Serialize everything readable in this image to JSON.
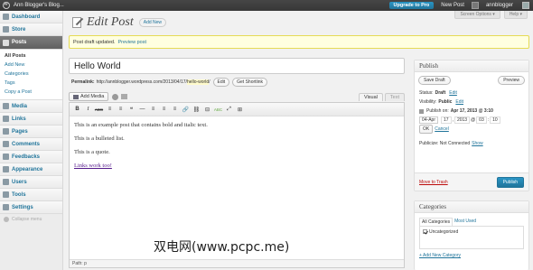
{
  "adminbar": {
    "site_name": "Ann Blogger's Blog...",
    "upgrade_label": "Upgrade to Pro",
    "new_post_label": "New Post",
    "username": "annblogger"
  },
  "screen_options": {
    "options_label": "Screen Options ▾",
    "help_label": "Help ▾"
  },
  "sidebar": {
    "items_top": [
      {
        "label": "Dashboard"
      },
      {
        "label": "Store"
      }
    ],
    "active": {
      "label": "Posts"
    },
    "submenu": [
      {
        "label": "All Posts"
      },
      {
        "label": "Add New"
      },
      {
        "label": "Categories"
      },
      {
        "label": "Tags"
      },
      {
        "label": "Copy a Post"
      }
    ],
    "items_bottom": [
      {
        "label": "Media"
      },
      {
        "label": "Links"
      },
      {
        "label": "Pages"
      },
      {
        "label": "Comments"
      },
      {
        "label": "Feedbacks"
      },
      {
        "label": "Appearance"
      },
      {
        "label": "Users"
      },
      {
        "label": "Tools"
      },
      {
        "label": "Settings"
      }
    ],
    "collapse_label": "Collapse menu"
  },
  "page": {
    "title": "Edit Post",
    "add_new_label": "Add New"
  },
  "notice": {
    "text": "Post draft updated.",
    "link": "Preview post"
  },
  "post": {
    "title": "Hello World",
    "permalink_label": "Permalink:",
    "permalink_base": "http://annblogger.wordpress.com/2013/04/17/",
    "permalink_slug": "hello-world",
    "permalink_end": "/",
    "edit_label": "Edit",
    "shortlink_label": "Get Shortlink"
  },
  "editor": {
    "add_media_label": "Add Media",
    "tab_visual": "Visual",
    "tab_text": "Text",
    "toolbar": [
      "B",
      "I",
      "ABC",
      "≡",
      "≡",
      "❝",
      "—",
      "≡",
      "≡",
      "≡",
      "🔗",
      "⛓",
      "⊟",
      "ABC",
      "⤢",
      "⊞"
    ],
    "content": [
      "This is an example post that contains bold and italic text.",
      "This is a bulleted list.",
      "This is a quote.",
      "Links work too!"
    ],
    "path": "Path: p"
  },
  "publish": {
    "title": "Publish",
    "save_draft_label": "Save Draft",
    "preview_label": "Preview",
    "status_label": "Status:",
    "status_value": "Draft",
    "visibility_label": "Visibility:",
    "visibility_value": "Public",
    "publish_on_label": "Publish on:",
    "publish_on_value": "Apr 17, 2013 @ 3:10",
    "edit_label": "Edit",
    "month": "04-Apr",
    "day": "17",
    "year": "2013",
    "hour": "03",
    "minute": "10",
    "ok_label": "OK",
    "cancel_label": "Cancel",
    "publicize_label": "Publicize:",
    "publicize_value": "Not Connected",
    "show_label": "Show",
    "trash_label": "Move to Trash",
    "publish_label": "Publish"
  },
  "categories": {
    "title": "Categories",
    "tab_all": "All Categories",
    "tab_most": "Most Used",
    "items": [
      "Uncategorized"
    ],
    "add_new_label": "+ Add New Category"
  },
  "watermark": "双电网(www.pcpc.me)"
}
